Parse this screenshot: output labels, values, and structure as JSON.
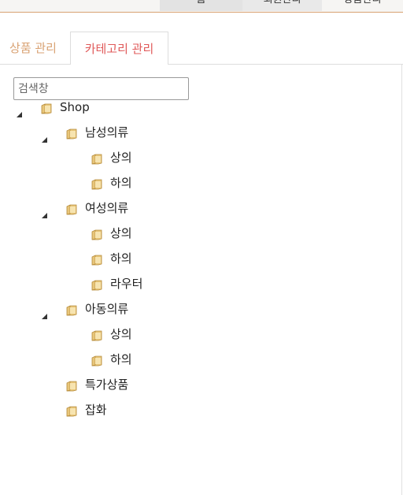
{
  "topnav": {
    "items": [
      "홈",
      "회원관리",
      "상품관리"
    ]
  },
  "tabs": [
    {
      "label": "상품 관리",
      "active": false
    },
    {
      "label": "카테고리 관리",
      "active": true
    }
  ],
  "search": {
    "placeholder": "검색창",
    "value": ""
  },
  "tree": {
    "root": {
      "label": "Shop",
      "expanded": true,
      "children": [
        {
          "label": "남성의류",
          "expanded": true,
          "children": [
            {
              "label": "상의"
            },
            {
              "label": "하의"
            }
          ]
        },
        {
          "label": "여성의류",
          "expanded": true,
          "children": [
            {
              "label": "상의"
            },
            {
              "label": "하의"
            },
            {
              "label": "라우터"
            }
          ]
        },
        {
          "label": "아동의류",
          "expanded": true,
          "children": [
            {
              "label": "상의"
            },
            {
              "label": "하의"
            }
          ]
        },
        {
          "label": "특가상품"
        },
        {
          "label": "잡화"
        }
      ]
    }
  },
  "colors": {
    "accent_tab": "#e05a5a",
    "inactive_tab": "#d9a273",
    "nav_line": "#d9a273"
  }
}
